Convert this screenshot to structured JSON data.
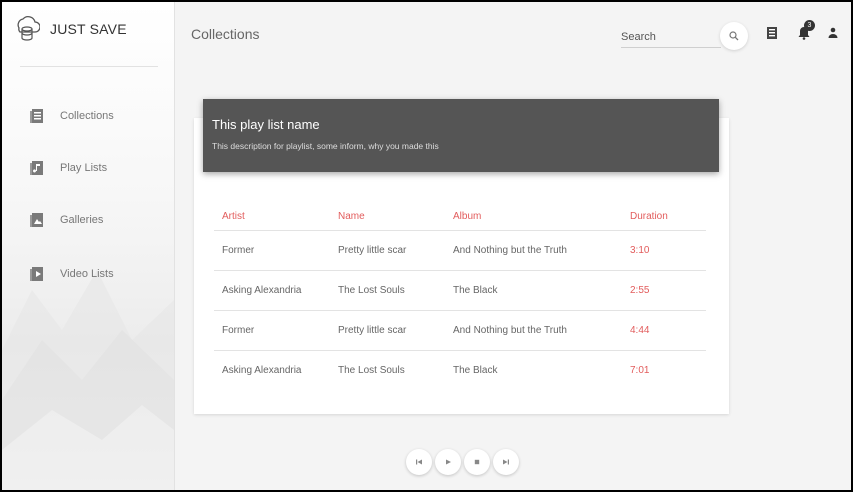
{
  "app": {
    "name": "JUST SAVE",
    "logo_icon": "cloud-database-icon"
  },
  "sidebar": {
    "items": [
      {
        "label": "Collections",
        "icon": "collection-icon"
      },
      {
        "label": "Play Lists",
        "icon": "playlist-icon"
      },
      {
        "label": "Galleries",
        "icon": "gallery-icon"
      },
      {
        "label": "Video Lists",
        "icon": "video-icon"
      }
    ]
  },
  "header": {
    "title": "Collections",
    "search": {
      "placeholder": "Search",
      "value": ""
    },
    "notification_count": "3"
  },
  "playlist": {
    "name": "This play list name",
    "description": "This description for playlist, some inform, why you made this"
  },
  "table": {
    "columns": [
      "Artist",
      "Name",
      "Album",
      "Duration"
    ],
    "rows": [
      [
        "Former",
        "Pretty little scar",
        "And Nothing but the Truth",
        "3:10"
      ],
      [
        "Asking Alexandria",
        "The Lost Souls",
        "The Black",
        "2:55"
      ],
      [
        "Former",
        "Pretty little scar",
        "And Nothing but the Truth",
        "4:44"
      ],
      [
        "Asking Alexandria",
        "The Lost Souls",
        "The Black",
        "7:01"
      ]
    ]
  },
  "player": {
    "controls": [
      "previous-icon",
      "play-icon",
      "stop-icon",
      "next-icon"
    ]
  },
  "colors": {
    "accent": "#e25c5c",
    "panel": "#555555",
    "sidebar_icon": "#7a7a7a"
  }
}
